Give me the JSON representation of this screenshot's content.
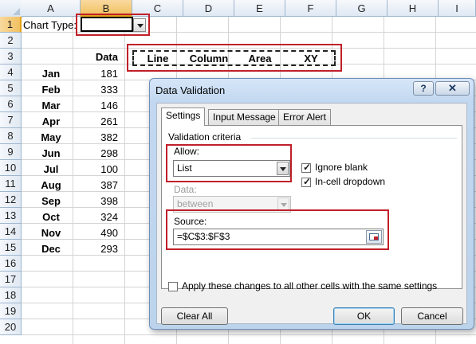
{
  "sheet": {
    "columns": [
      "A",
      "B",
      "C",
      "D",
      "E",
      "F",
      "G",
      "H",
      "I"
    ],
    "selected_column": "B",
    "rows": [
      "1",
      "2",
      "3",
      "4",
      "5",
      "6",
      "7",
      "8",
      "9",
      "10",
      "11",
      "12",
      "13",
      "14",
      "15",
      "16",
      "17",
      "18",
      "19",
      "20"
    ],
    "selected_row": "1",
    "chart_type_label": "Chart Type:",
    "data_header": "Data",
    "months": [
      "Jan",
      "Feb",
      "Mar",
      "Apr",
      "May",
      "Jun",
      "Jul",
      "Aug",
      "Sep",
      "Oct",
      "Nov",
      "Dec"
    ],
    "values": [
      "181",
      "333",
      "146",
      "261",
      "382",
      "298",
      "100",
      "387",
      "398",
      "324",
      "490",
      "293"
    ],
    "chart_types": [
      "Line",
      "Column",
      "Area",
      "XY"
    ]
  },
  "dialog": {
    "title": "Data Validation",
    "help_label": "?",
    "close_label": "✕",
    "tabs": [
      "Settings",
      "Input Message",
      "Error Alert"
    ],
    "active_tab": "Settings",
    "criteria_label": "Validation criteria",
    "allow_label": "Allow:",
    "allow_value": "List",
    "ignore_blank_label": "Ignore blank",
    "ignore_blank_checked": true,
    "in_cell_dropdown_label": "In-cell dropdown",
    "in_cell_dropdown_checked": true,
    "data_label": "Data:",
    "data_value": "between",
    "source_label": "Source:",
    "source_value": "=$C$3:$F$3",
    "apply_all_label": "Apply these changes to all other cells with the same settings",
    "apply_all_checked": false,
    "clear_all_label": "Clear All",
    "ok_label": "OK",
    "cancel_label": "Cancel"
  },
  "colors": {
    "highlight_red": "#c0202a",
    "selected_header": "#f1c15f",
    "dialog_frame": "#c2d8f0"
  }
}
